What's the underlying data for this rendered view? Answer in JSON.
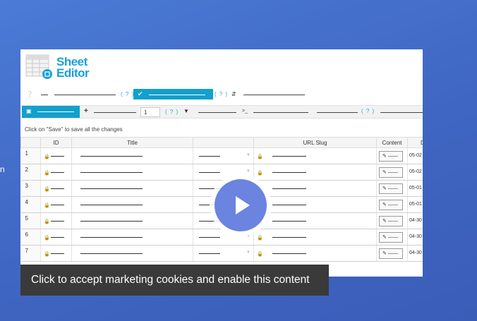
{
  "edge_text": "n",
  "logo": {
    "line1": "Sheet",
    "line2": "Editor"
  },
  "toolbar": {
    "help_icon": "question-circle-icon",
    "help_label": "( ? )",
    "check_icon": "check-icon",
    "save_icon": "floppy-disk-icon",
    "plus_icon": "plus-icon",
    "filter_icon": "filter-icon",
    "sort_icon": "sort-icon",
    "terminal_label": ">_",
    "rows_value": "1"
  },
  "hint": "Click on \"Save\" to save all the changes",
  "table": {
    "columns": [
      "",
      "ID",
      "Title",
      "",
      "URL Slug",
      "Content",
      "D"
    ],
    "rows": [
      {
        "num": "1",
        "date": "05-02"
      },
      {
        "num": "2",
        "date": "05-02"
      },
      {
        "num": "3",
        "date": "05-01"
      },
      {
        "num": "4",
        "date": "05-01"
      },
      {
        "num": "5",
        "date": "04-30"
      },
      {
        "num": "6",
        "date": "04-30"
      },
      {
        "num": "7",
        "date": "04-30"
      }
    ],
    "lock_icon": "lock-icon",
    "edit_icon": "edit-icon"
  },
  "cookie_notice": "Click to accept marketing cookies and enable this content",
  "colors": {
    "accent": "#12a0cc",
    "background": "#4a7bd6",
    "play": "#6a84e0"
  }
}
